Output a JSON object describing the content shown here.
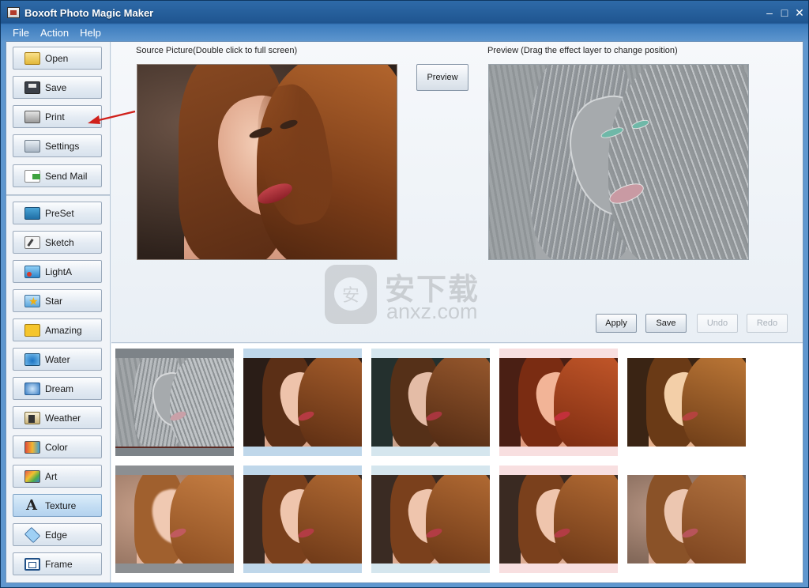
{
  "window": {
    "title": "Boxoft Photo Magic Maker",
    "controls": {
      "minimize": "–",
      "maximize": "□",
      "close": "✕"
    }
  },
  "menu": [
    "File",
    "Action",
    "Help"
  ],
  "sidebar": {
    "file_buttons": [
      {
        "label": "Open",
        "icon": "folder-icon"
      },
      {
        "label": "Save",
        "icon": "disk-icon"
      },
      {
        "label": "Print",
        "icon": "printer-icon"
      },
      {
        "label": "Settings",
        "icon": "settings-icon"
      },
      {
        "label": "Send Mail",
        "icon": "mail-icon"
      }
    ],
    "effect_buttons": [
      {
        "label": "PreSet",
        "icon": "preset-icon"
      },
      {
        "label": "Sketch",
        "icon": "sketch-icon"
      },
      {
        "label": "LightA",
        "icon": "light-icon"
      },
      {
        "label": "Star",
        "icon": "star-icon"
      },
      {
        "label": "Amazing",
        "icon": "amazing-icon"
      },
      {
        "label": "Water",
        "icon": "water-icon"
      },
      {
        "label": "Dream",
        "icon": "dream-icon"
      },
      {
        "label": "Weather",
        "icon": "weather-icon"
      },
      {
        "label": "Color",
        "icon": "color-icon"
      },
      {
        "label": "Art",
        "icon": "art-icon"
      },
      {
        "label": "Texture",
        "icon": "texture-icon",
        "selected": true
      },
      {
        "label": "Edge",
        "icon": "edge-icon"
      },
      {
        "label": "Frame",
        "icon": "frame-icon"
      }
    ]
  },
  "workspace": {
    "source_caption": "Source Picture(Double click to full screen)",
    "preview_caption": "Preview (Drag the effect layer to change position)",
    "preview_button": "Preview",
    "actions": {
      "apply": "Apply",
      "save": "Save",
      "undo": "Undo",
      "redo": "Redo"
    },
    "watermark": {
      "cn": "安下载",
      "en": "anxz.com",
      "shield": "安"
    }
  },
  "colors": {
    "title_bar": "#1f5590",
    "accent": "#3b7bbd",
    "arrow": "#d0201a"
  }
}
